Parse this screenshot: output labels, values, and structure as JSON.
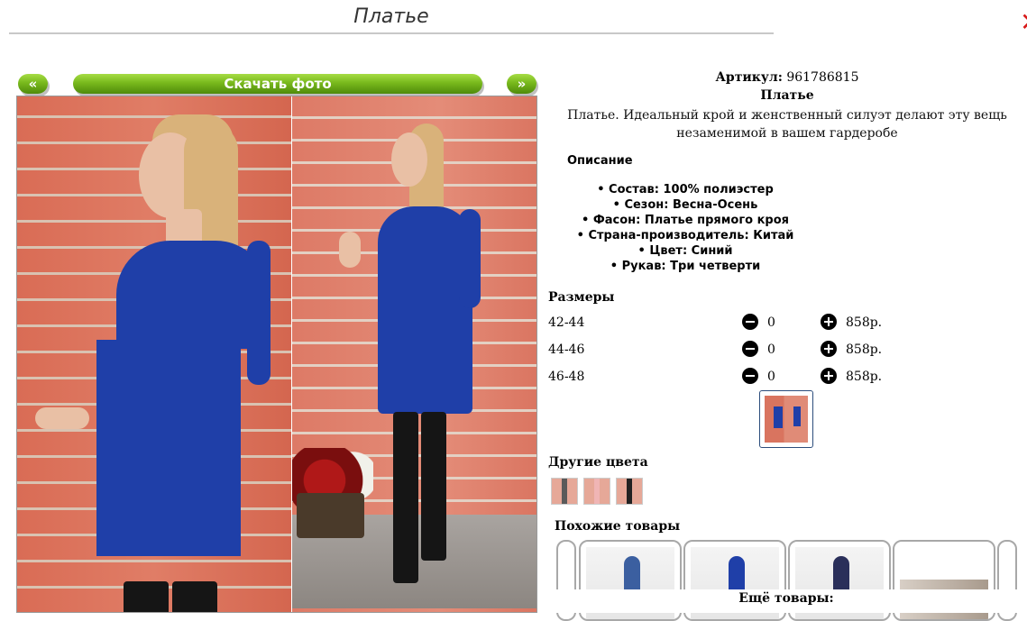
{
  "header": {
    "title": "Платье"
  },
  "photo_nav": {
    "prev": "«",
    "download": "Скачать фото",
    "next": "»"
  },
  "product": {
    "sku_label": "Артикул:",
    "sku": "961786815",
    "name": "Платье",
    "description": "Платье. Идеальный крой и женственный силуэт делают эту вещь незаменимой в вашем гардеробе"
  },
  "description_section": {
    "heading": "Описание",
    "attributes": [
      "Состав: 100% полиэстер",
      "Сезон: Весна-Осень",
      "Фасон: Платье прямого кроя",
      "Страна-производитель: Китай",
      "Цвет: Синий",
      "Рукав: Три четверти"
    ]
  },
  "sizes": {
    "heading": "Размеры",
    "rows": [
      {
        "size": "42-44",
        "qty": "0",
        "price": "858р."
      },
      {
        "size": "44-46",
        "qty": "0",
        "price": "858р."
      },
      {
        "size": "46-48",
        "qty": "0",
        "price": "858р."
      }
    ]
  },
  "other_colors": {
    "heading": "Другие цвета"
  },
  "similar": {
    "heading": "Похожие товары"
  },
  "more": {
    "heading": "Ещё товары:"
  },
  "colors": {
    "accent_green": "#78b91c",
    "dress_blue": "#1f3fa8"
  }
}
